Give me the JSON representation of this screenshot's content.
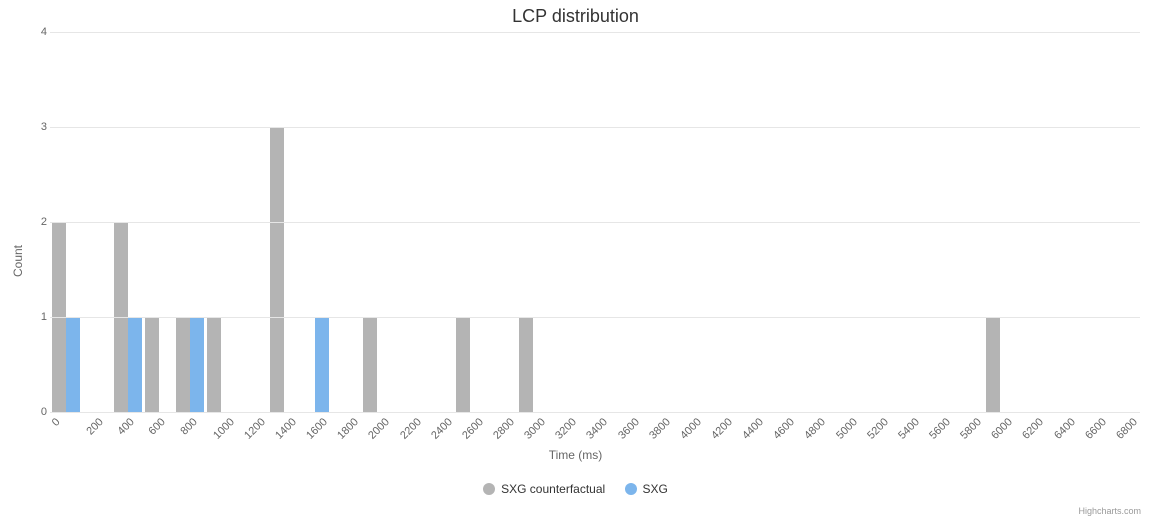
{
  "chart_data": {
    "type": "bar",
    "title": "LCP distribution",
    "xlabel": "Time (ms)",
    "ylabel": "Count",
    "ylim": [
      0,
      4
    ],
    "yticks": [
      0,
      1,
      2,
      3,
      4
    ],
    "categories": [
      0,
      200,
      400,
      600,
      800,
      1000,
      1200,
      1400,
      1600,
      1800,
      2000,
      2200,
      2400,
      2600,
      2800,
      3000,
      3200,
      3400,
      3600,
      3800,
      4000,
      4200,
      4400,
      4600,
      4800,
      5000,
      5200,
      5400,
      5600,
      5800,
      6000,
      6200,
      6400,
      6600,
      6800
    ],
    "series": [
      {
        "name": "SXG counterfactual",
        "color": "#b4b4b4",
        "values": [
          2,
          0,
          2,
          1,
          1,
          1,
          0,
          3,
          0,
          0,
          1,
          0,
          0,
          1,
          0,
          1,
          0,
          0,
          0,
          0,
          0,
          0,
          0,
          0,
          0,
          0,
          0,
          0,
          0,
          0,
          1,
          0,
          0,
          0,
          0
        ]
      },
      {
        "name": "SXG",
        "color": "#7cb5ec",
        "values": [
          1,
          0,
          1,
          0,
          1,
          0,
          0,
          0,
          1,
          0,
          0,
          0,
          0,
          0,
          0,
          0,
          0,
          0,
          0,
          0,
          0,
          0,
          0,
          0,
          0,
          0,
          0,
          0,
          0,
          0,
          0,
          0,
          0,
          0,
          0
        ]
      }
    ]
  },
  "credits": "Highcharts.com"
}
